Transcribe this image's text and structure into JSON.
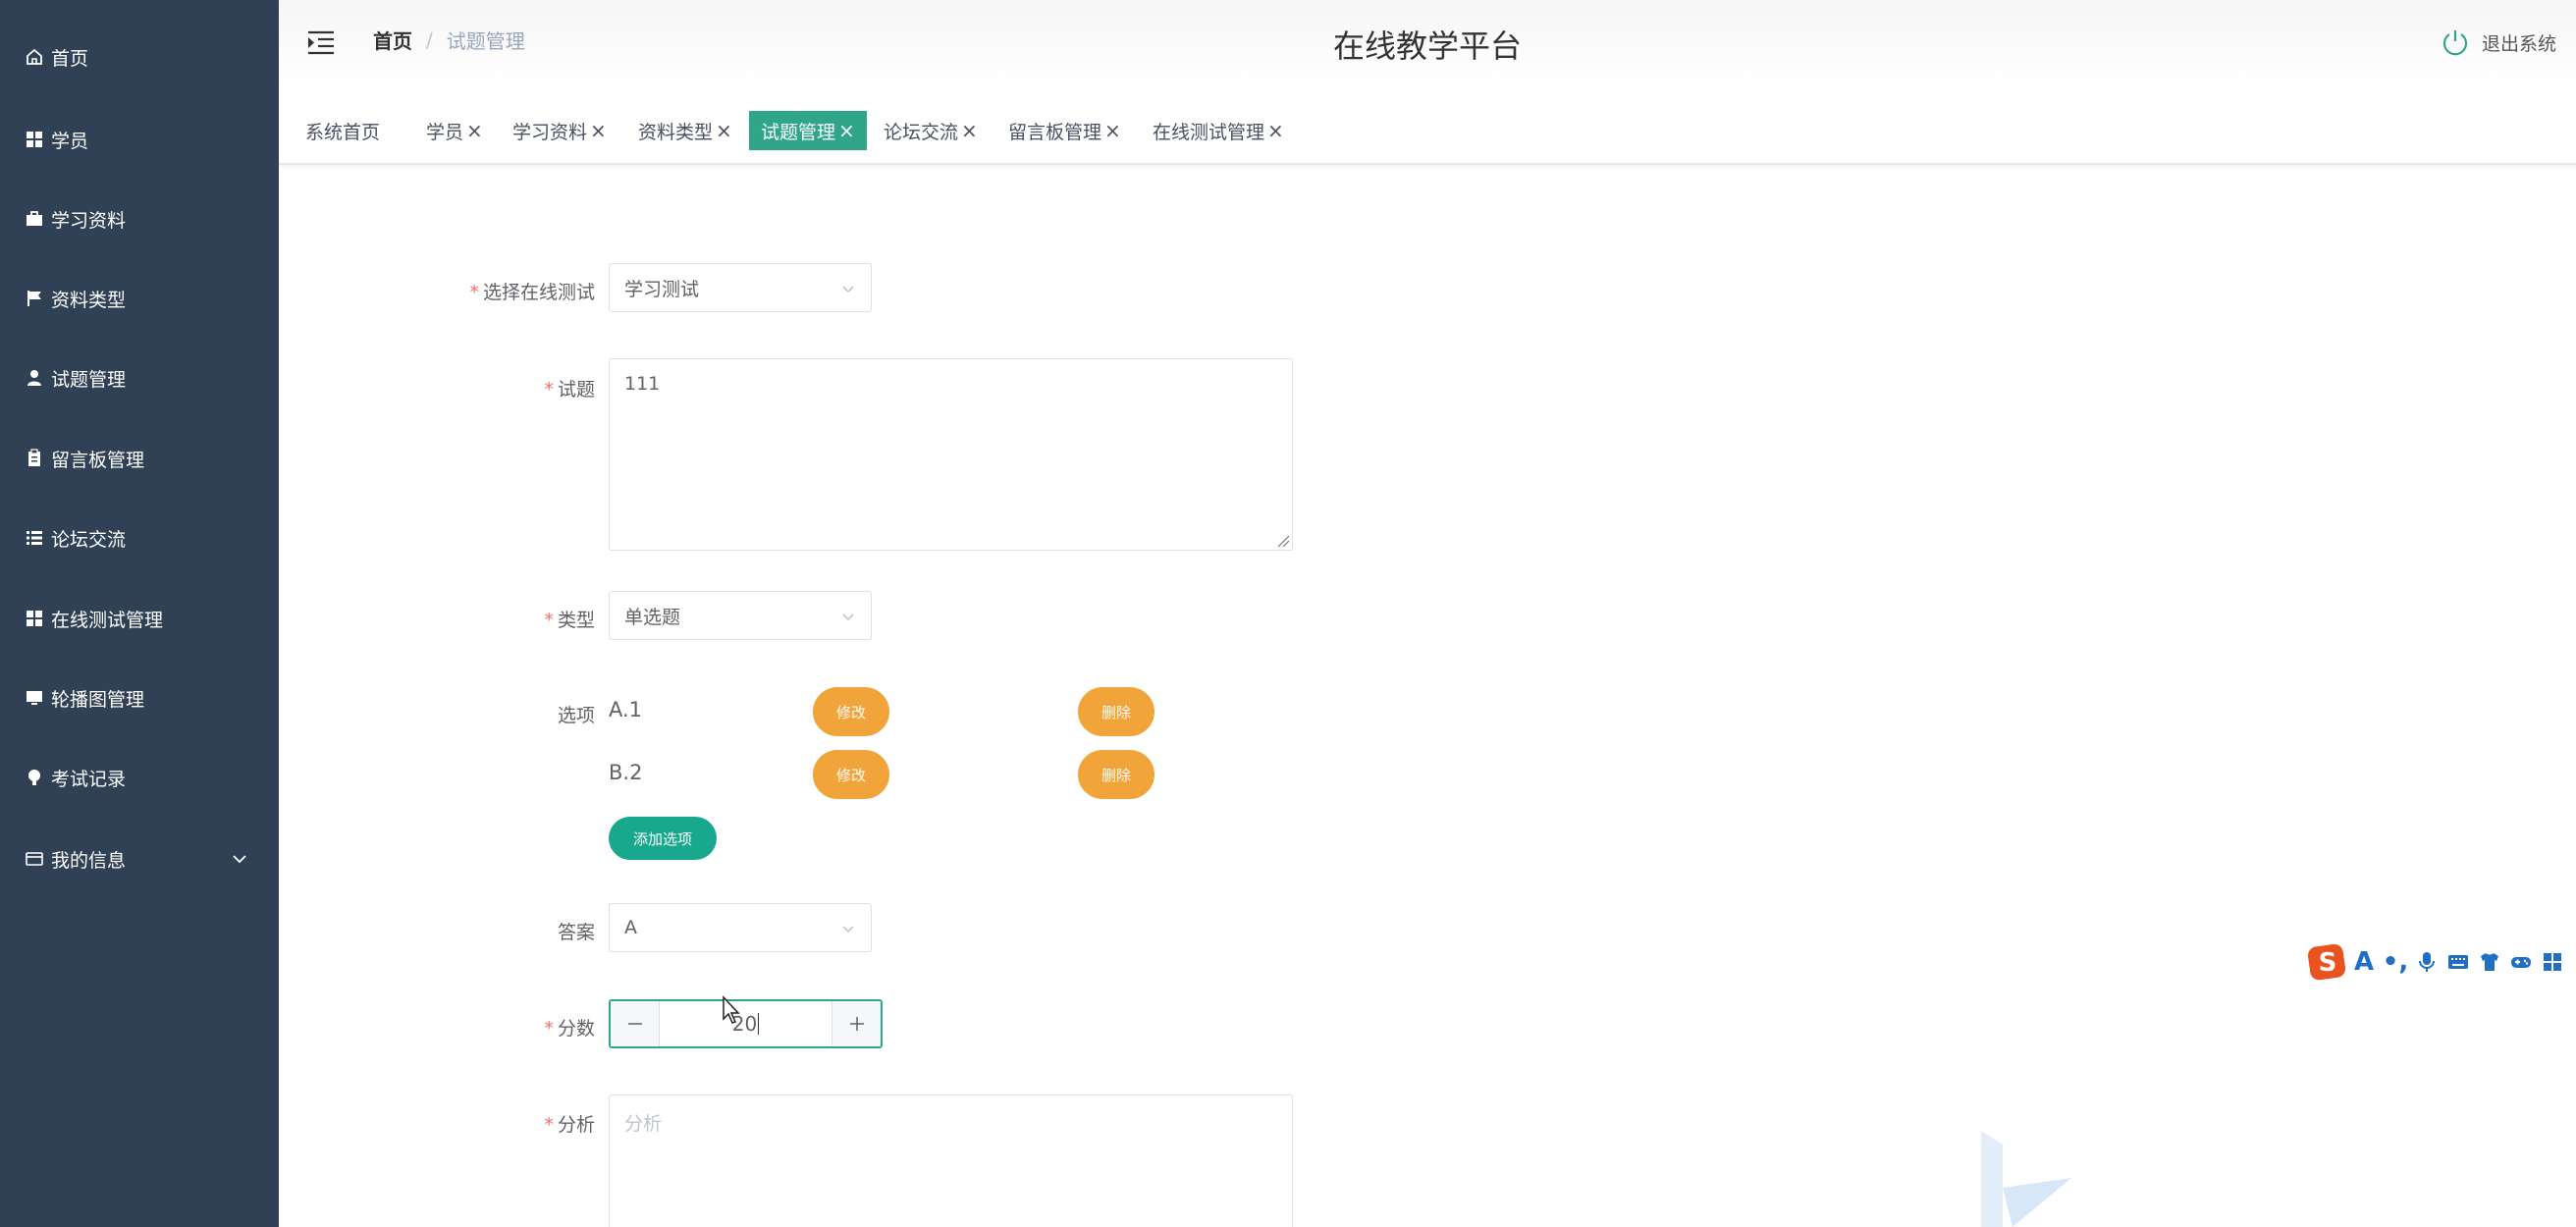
{
  "sidebar": {
    "items": [
      {
        "label": "首页",
        "icon": "home-icon"
      },
      {
        "label": "学员",
        "icon": "grid-icon"
      },
      {
        "label": "学习资料",
        "icon": "briefcase-icon"
      },
      {
        "label": "资料类型",
        "icon": "flag-icon"
      },
      {
        "label": "试题管理",
        "icon": "user-icon"
      },
      {
        "label": "留言板管理",
        "icon": "clipboard-icon"
      },
      {
        "label": "论坛交流",
        "icon": "list-icon"
      },
      {
        "label": "在线测试管理",
        "icon": "grid-icon"
      },
      {
        "label": "轮播图管理",
        "icon": "monitor-icon"
      },
      {
        "label": "考试记录",
        "icon": "bulb-icon"
      },
      {
        "label": "我的信息",
        "icon": "card-icon",
        "expandable": true
      }
    ]
  },
  "header": {
    "breadcrumb_home": "首页",
    "breadcrumb_separator": "/",
    "breadcrumb_current": "试题管理",
    "title": "在线教学平台",
    "logout_label": "退出系统"
  },
  "tabs": [
    {
      "label": "系统首页",
      "closable": false,
      "active": false
    },
    {
      "label": "学员",
      "closable": true,
      "active": false
    },
    {
      "label": "学习资料",
      "closable": true,
      "active": false
    },
    {
      "label": "资料类型",
      "closable": true,
      "active": false
    },
    {
      "label": "试题管理",
      "closable": true,
      "active": true
    },
    {
      "label": "论坛交流",
      "closable": true,
      "active": false
    },
    {
      "label": "留言板管理",
      "closable": true,
      "active": false
    },
    {
      "label": "在线测试管理",
      "closable": true,
      "active": false
    }
  ],
  "tab_close_symbol": "×",
  "required_mark": "*",
  "form": {
    "test_label": "选择在线测试",
    "test_value": "学习测试",
    "question_label": "试题",
    "question_value": "111",
    "type_label": "类型",
    "type_value": "单选题",
    "options_label": "选项",
    "options": [
      {
        "text": "A.1",
        "edit_label": "修改",
        "delete_label": "删除"
      },
      {
        "text": "B.2",
        "edit_label": "修改",
        "delete_label": "删除"
      }
    ],
    "add_option_label": "添加选项",
    "answer_label": "答案",
    "answer_value": "A",
    "score_label": "分数",
    "score_value": "20",
    "analysis_label": "分析",
    "analysis_placeholder": "分析"
  },
  "ime_toolbar": {
    "logo_letter": "S",
    "items": [
      "A",
      "•,"
    ]
  },
  "colors": {
    "sidebar_bg": "#304156",
    "accent": "#2fa68a",
    "orange": "#f0a43a",
    "required": "#f56c6c"
  }
}
